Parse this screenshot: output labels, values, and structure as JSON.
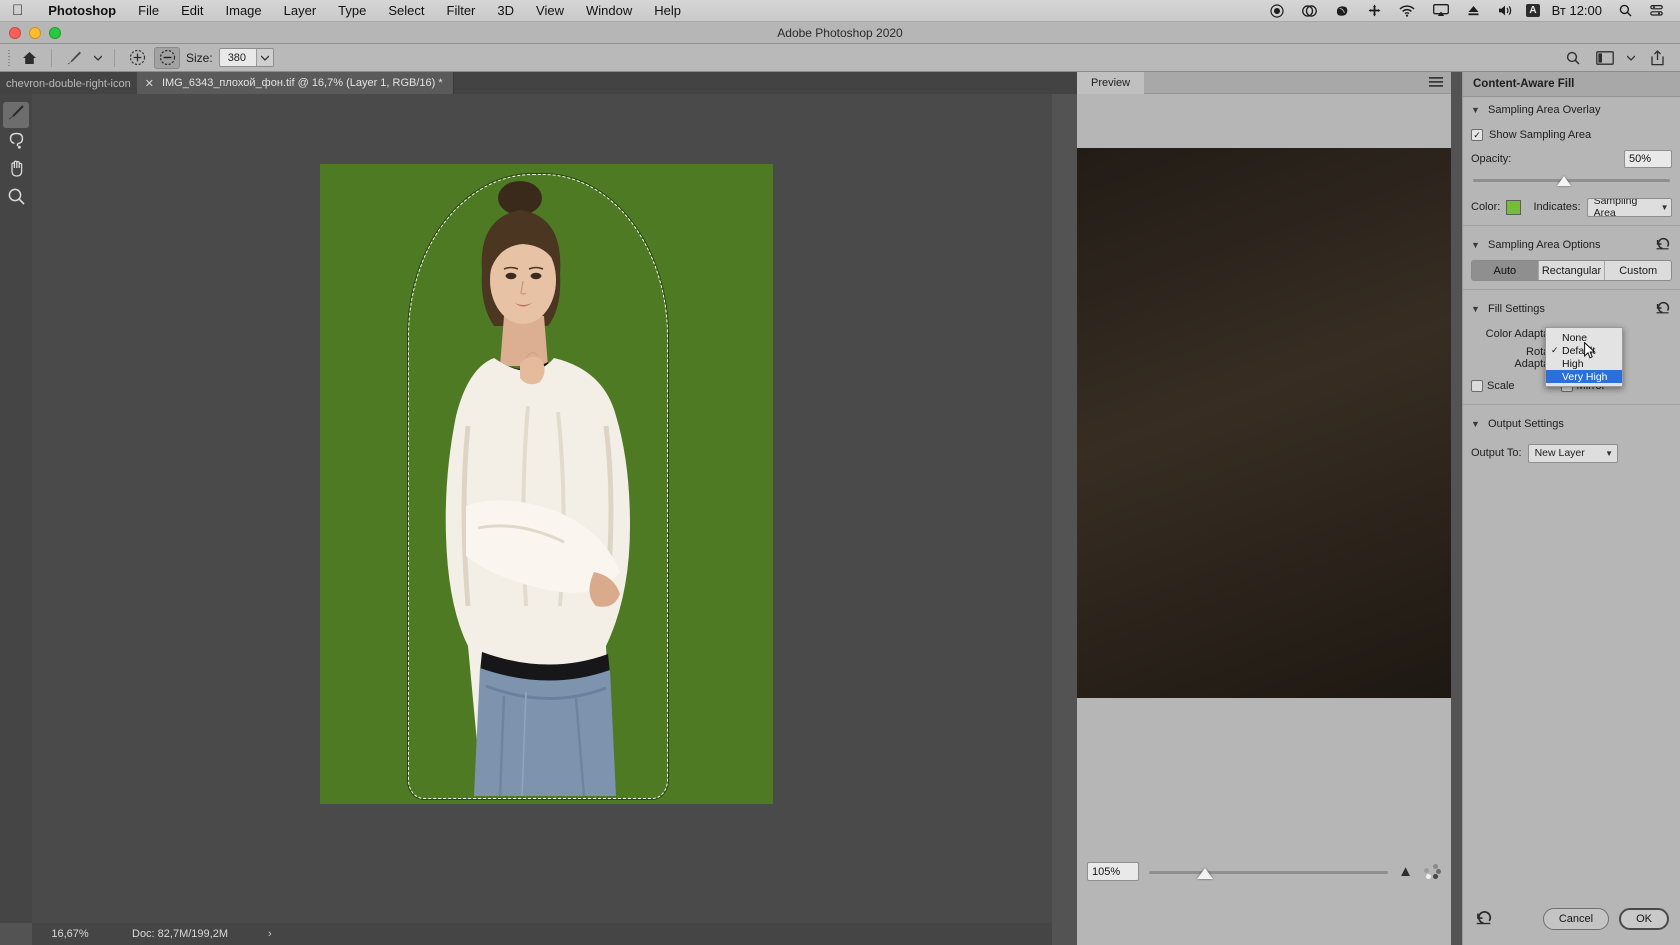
{
  "menubar": {
    "apple": "apple-logo",
    "items": [
      "Photoshop",
      "File",
      "Edit",
      "Image",
      "Layer",
      "Type",
      "Select",
      "Filter",
      "3D",
      "View",
      "Window",
      "Help"
    ],
    "status_icons": [
      "record-icon",
      "dropbox-icon",
      "evernote-icon",
      "vpn-icon",
      "wifi-icon",
      "airplay-icon",
      "eject-icon",
      "volume-icon"
    ],
    "input_badge": "A",
    "clock": "Вт 12:00",
    "search_icon": "search-icon",
    "control_center_icon": "control-center-icon"
  },
  "titlebar": {
    "title": "Adobe Photoshop 2020"
  },
  "optionsbar": {
    "home_icon": "home-icon",
    "brush_icon": "brush-preset-icon",
    "brush_arrow": "chevron-down-icon",
    "add_icon": "add-to-selection-icon",
    "subtract_icon": "subtract-from-selection-icon",
    "size_label": "Size:",
    "size_value": "380",
    "size_arrow": "chevron-down-icon",
    "right_icons": [
      "search-icon",
      "workspace-icon",
      "chevron-down-icon",
      "share-icon"
    ]
  },
  "document": {
    "tab_title": "IMG_6343_плохой_фон.tif @ 16,7% (Layer 1, RGB/16) *",
    "tab_close": "close-icon",
    "overflow_chevron": "chevron-double-right-icon"
  },
  "tools": [
    {
      "name": "brush-tool",
      "glyph": "brush-icon",
      "active": true
    },
    {
      "name": "lasso-tool",
      "glyph": "lasso-icon",
      "active": false
    },
    {
      "name": "hand-tool",
      "glyph": "hand-icon",
      "active": false
    },
    {
      "name": "zoom-tool",
      "glyph": "magnifier-icon",
      "active": false
    }
  ],
  "statusbar": {
    "zoom": "16,67%",
    "doc": "Doc: 82,7M/199,2M",
    "arrow": "›"
  },
  "preview": {
    "tab_label": "Preview",
    "menu_icon": "panel-menu-icon",
    "zoom_value": "105%",
    "warning_icon": "warning-icon",
    "busy_icon": "busy-dots-icon"
  },
  "caf": {
    "title": "Content-Aware Fill",
    "sampling_overlay": {
      "section": "Sampling Area Overlay",
      "show_label": "Show Sampling Area",
      "show_checked": true,
      "opacity_label": "Opacity:",
      "opacity_value": "50%",
      "color_label": "Color:",
      "color_hex": "#76bb3a",
      "indicates_label": "Indicates:",
      "indicates_value": "Sampling Area"
    },
    "sampling_options": {
      "section": "Sampling Area Options",
      "reset_icon": "reset-icon",
      "segments": [
        "Auto",
        "Rectangular",
        "Custom"
      ],
      "active_segment": "Auto"
    },
    "fill_settings": {
      "section": "Fill Settings",
      "reset_icon": "reset-icon",
      "color_adaptation_label": "Color Adaptation",
      "rotation_adaptation_label": "Rotation Adaptation",
      "scale_label": "Scale",
      "scale_checked": false,
      "mirror_label": "Mirror",
      "mirror_checked": false
    },
    "output_settings": {
      "section": "Output Settings",
      "output_to_label": "Output To:",
      "output_to_value": "New Layer"
    },
    "footer": {
      "reset_icon": "reset-icon",
      "cancel_label": "Cancel",
      "ok_label": "OK"
    }
  },
  "dropdown": {
    "items": [
      {
        "label": "None",
        "checked": false,
        "highlighted": false
      },
      {
        "label": "Default",
        "checked": true,
        "highlighted": false
      },
      {
        "label": "High",
        "checked": false,
        "highlighted": false
      },
      {
        "label": "Very High",
        "checked": false,
        "highlighted": true
      }
    ],
    "check_glyph": "✓",
    "highlight_hex": "#2a6fdb"
  },
  "colors": {
    "canvas_bg": "#4a4a4a",
    "photo_backdrop": "#4d7a23",
    "panel_bg": "#b6b6b6",
    "accent": "#2a6fdb"
  }
}
